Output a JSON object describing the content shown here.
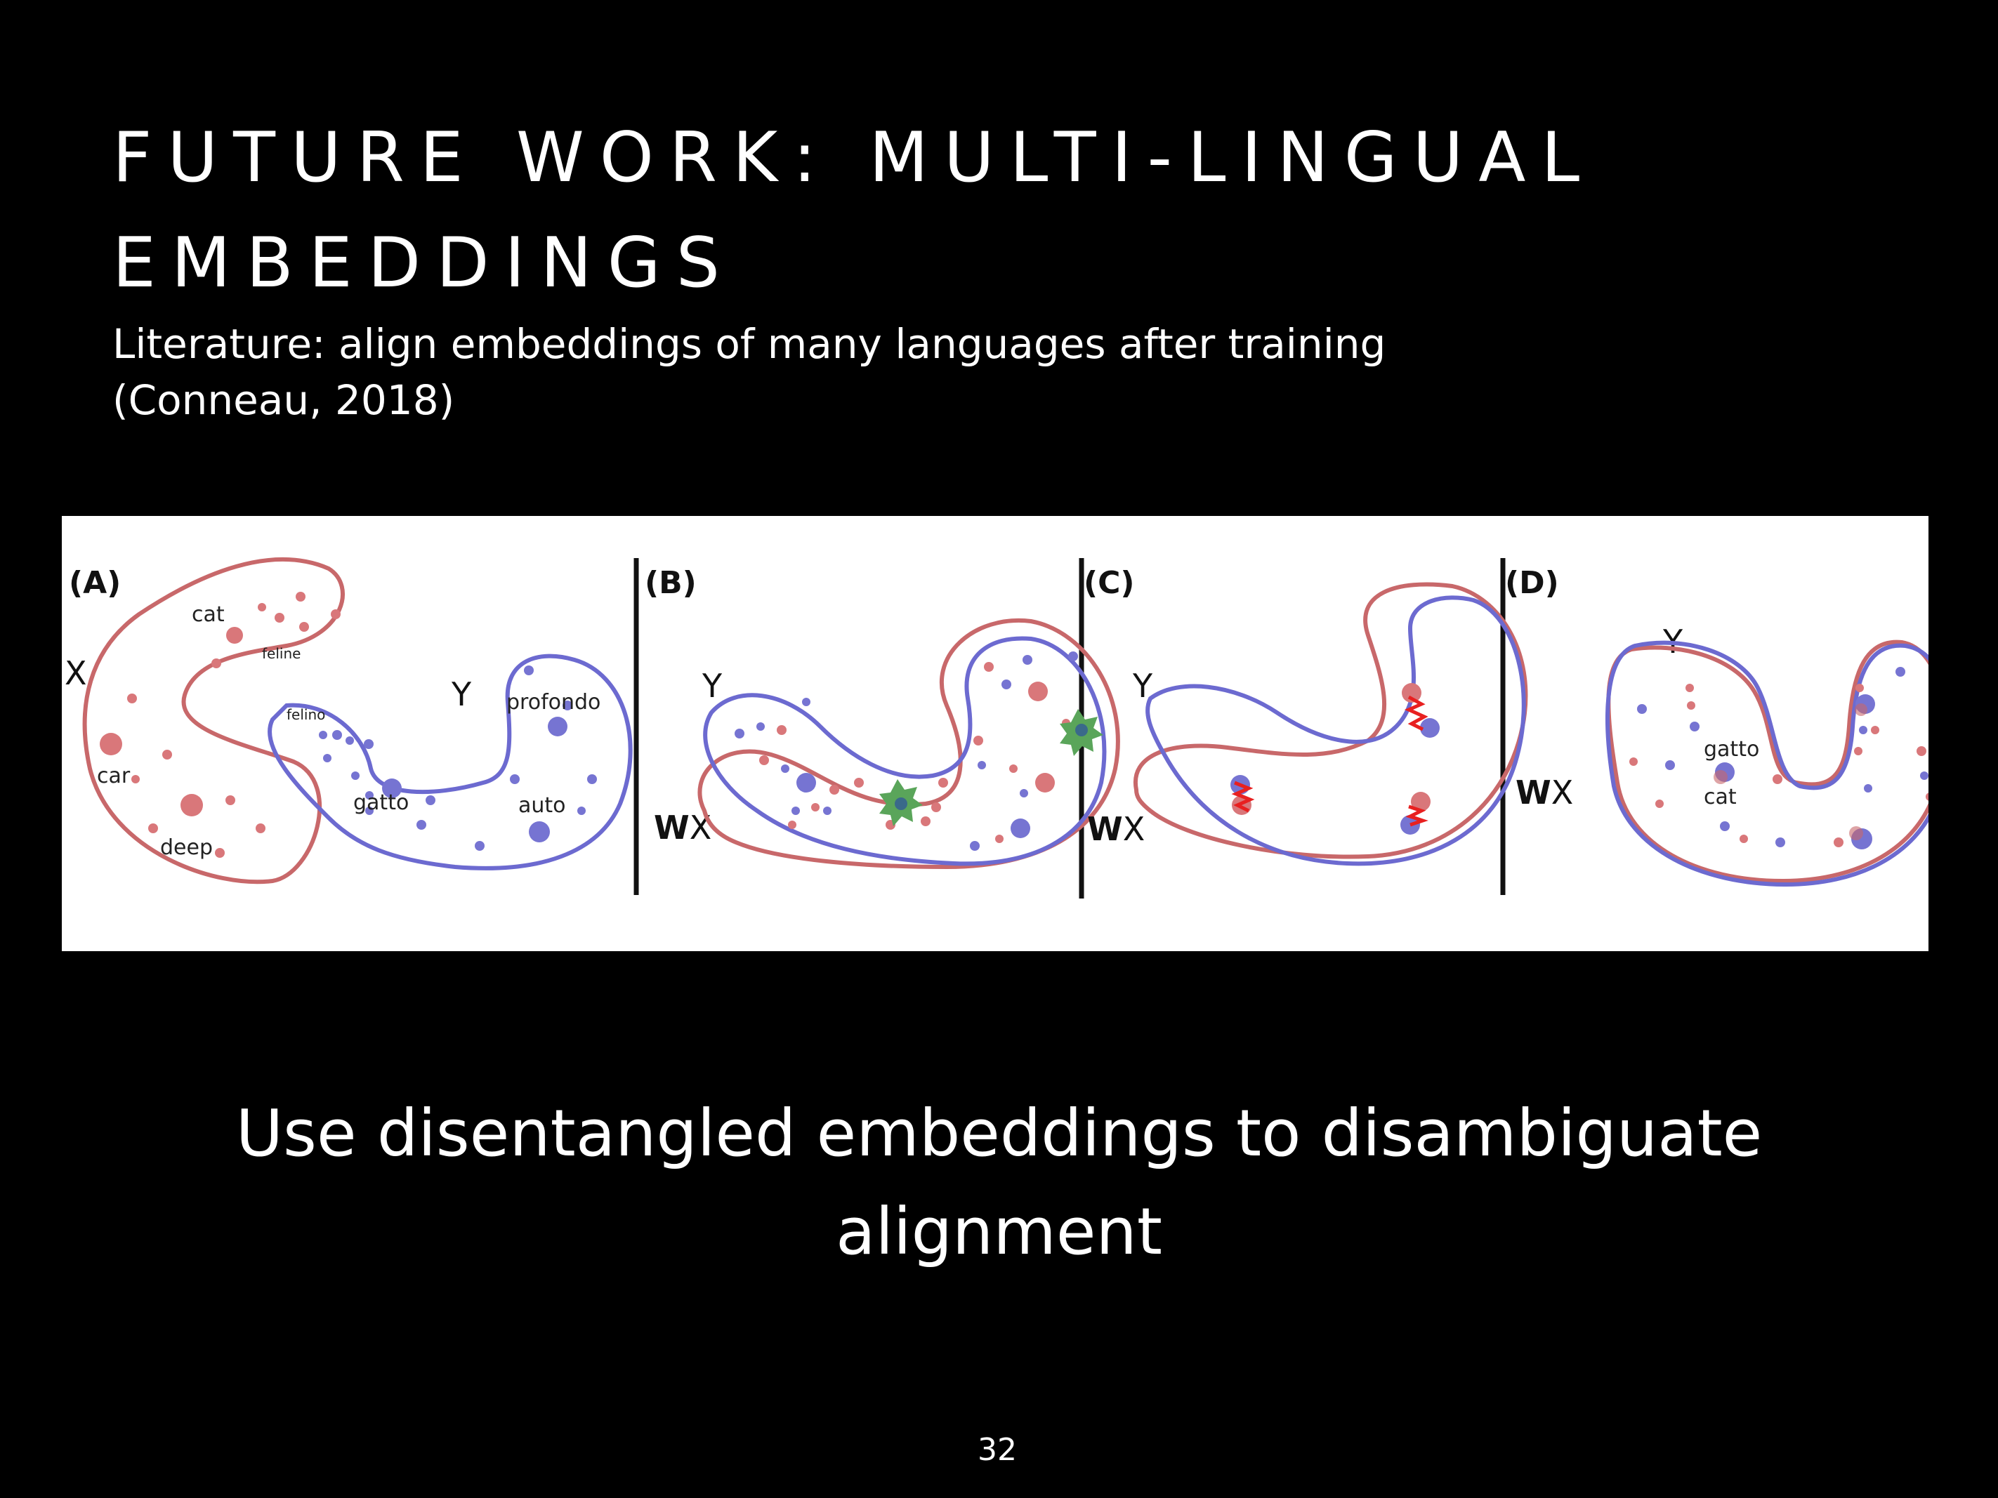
{
  "slide": {
    "title_line1": "FUTURE WORK: MULTI-LINGUAL",
    "title_line2": "EMBEDDINGS",
    "subtitle_line1": "Literature: align embeddings of many languages after training",
    "subtitle_line2": "(Conneau, 2018)",
    "body_line1": "Use disentangled embeddings to disambiguate",
    "body_line2": "alignment",
    "page_number": "32"
  },
  "figure": {
    "panels": [
      "(A)",
      "(B)",
      "(C)",
      "(D)"
    ],
    "space_labels": {
      "x": "X",
      "y": "Y",
      "wx_w": "W",
      "wx_x": "X"
    },
    "words_a_red": [
      "cat",
      "feline",
      "car",
      "deep"
    ],
    "words_a_blue": [
      "felino",
      "profondo",
      "gatto",
      "auto"
    ],
    "words_d": [
      "gatto",
      "cat"
    ],
    "colors": {
      "red": "#d9777a",
      "blue": "#7674d2",
      "green": "#5aa55a",
      "outline_red": "#c8686a",
      "outline_blue": "#6c6ad0"
    }
  }
}
